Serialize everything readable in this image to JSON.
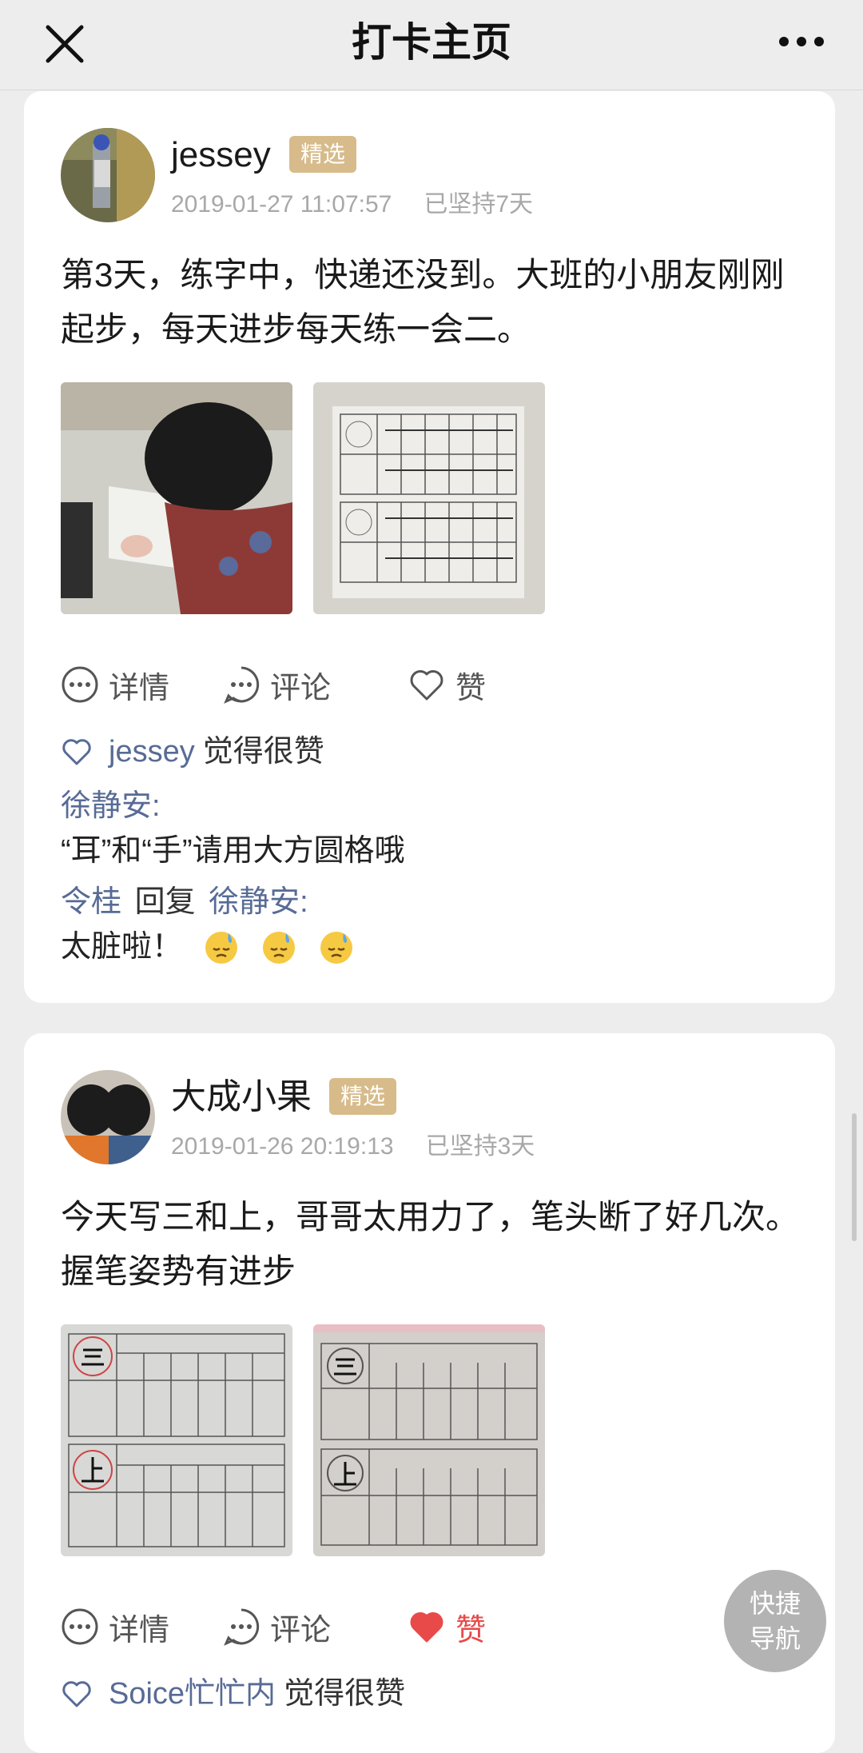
{
  "header": {
    "title": "打卡主页"
  },
  "posts": [
    {
      "user": "jessey",
      "badge": "精选",
      "timestamp": "2019-01-27 11:07:57",
      "streak": "已坚持7天",
      "text": "第3天，练字中，快递还没到。大班的小朋友刚刚起步，每天进步每天练一会二。",
      "actions": {
        "detail": "详情",
        "comment": "评论",
        "like": "赞"
      },
      "liked_by": {
        "name": "jessey",
        "suffix": "觉得很赞"
      },
      "comments": [
        {
          "author": "徐静安:",
          "text": "“耳”和“手”请用大方圆格哦"
        },
        {
          "author": "令桂",
          "reply_word": "回复",
          "reply_to": "徐静安:",
          "text": "太脏啦！"
        }
      ]
    },
    {
      "user": "大成小果",
      "badge": "精选",
      "timestamp": "2019-01-26 20:19:13",
      "streak": "已坚持3天",
      "text": "今天写三和上，哥哥太用力了，笔头断了好几次。握笔姿势有进步",
      "actions": {
        "detail": "详情",
        "comment": "评论",
        "like": "赞"
      },
      "liked_by": {
        "name": "Soice忙忙内",
        "suffix": "觉得很赞"
      }
    }
  ],
  "fab": {
    "line1": "快捷",
    "line2": "导航"
  },
  "colors": {
    "badge": "#d7bb8a",
    "link": "#576b95",
    "liked": "#e84a4a"
  }
}
